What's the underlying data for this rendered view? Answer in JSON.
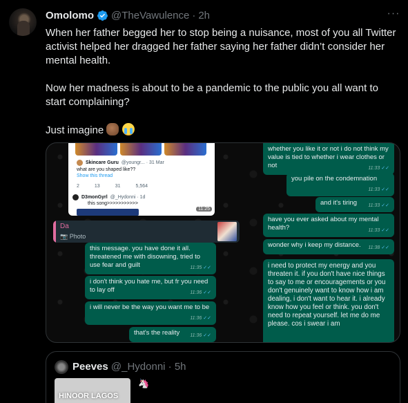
{
  "header": {
    "name": "Omolomo",
    "handle": "@TheVawulence",
    "separator": "·",
    "time": "2h",
    "more": "···"
  },
  "tweet": {
    "paragraph1": "When her father begged her to stop being a nuisance, most of you all Twitter activist helped her dragged her father saying her father didn’t consider her mental health.",
    "paragraph2": "Now her madness is about to be a pandemic to the public you all want to start complaining?",
    "paragraph3": "Just imagine",
    "emojis": [
      "fist-icon",
      "crying-face-icon"
    ]
  },
  "media": {
    "screenshot": {
      "author": "Skincare Guru",
      "author_handle": "@youngr... · 31 Mar",
      "question": "what are you shaped like??",
      "show_thread": "Show this thread",
      "actions": [
        "2",
        "13",
        "31",
        "5,564"
      ],
      "reply_author": "D3monGyrl",
      "reply_handle": "@_Hydonni · 1d",
      "reply_text": "this song>>>>>>>>>>>",
      "timestamp": "11:25"
    },
    "quoted_reply": {
      "name": "Da",
      "kind": "Photo"
    },
    "left_messages": [
      {
        "text": "this message. you have done it all. threatened me with disowning, tried to use fear and guilt",
        "time": "11:35"
      },
      {
        "text": "i don't think you hate me, but fr you need to lay off",
        "time": "11:36"
      },
      {
        "text": "i will never be the way you want me to be",
        "time": "11:36"
      },
      {
        "text": "that's the reality",
        "time": "11:36"
      }
    ],
    "right_messages": [
      {
        "text": "whether you like it or not i do not think my value is tied to whether i wear clothes or not",
        "time": "11:33"
      },
      {
        "text": "you pile on the condemnation",
        "time": "11:33"
      },
      {
        "text": "and it's tiring",
        "time": "11:33"
      },
      {
        "text": "have you ever asked about my mental health?",
        "time": "11:33"
      },
      {
        "text": "wonder why i keep my distance.",
        "time": "11:38"
      },
      {
        "text": "i need to protect my energy and you threaten it. if you don't have nice things to say to me or encouragements or you don't genuinely want to know how i am dealing, i don't want to hear it. i already know how you feel or think. you don't need to repeat yourself. let me do me please. cos i swear i am",
        "time": ""
      }
    ],
    "read_receipt": "✓✓"
  },
  "quoted_tweet": {
    "name": "Peeves",
    "handle": "@_Hydonni",
    "separator": "·",
    "time": "5h",
    "image_text": "HINOOR LAGOS",
    "emoji": "unicorn-icon"
  },
  "colors": {
    "background": "#000000",
    "text": "#e7e9ea",
    "muted": "#71767b",
    "verified": "#1d9bf0",
    "bubble_out": "#005c4b",
    "border": "#2f3336"
  }
}
